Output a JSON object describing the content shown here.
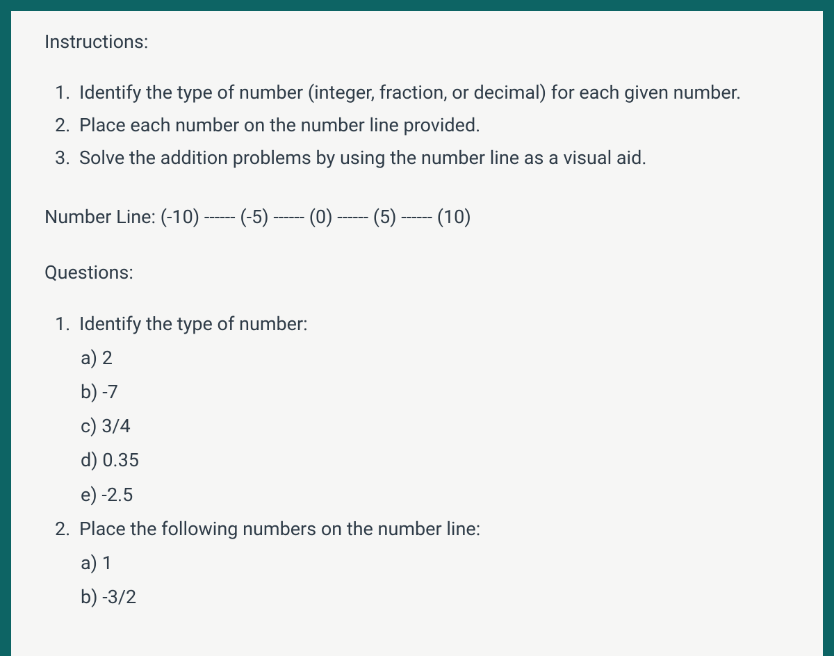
{
  "instructions_heading": "Instructions:",
  "instructions": [
    "Identify the type of number (integer, fraction, or decimal) for each given number.",
    "Place each number on the number line provided.",
    "Solve the addition problems by using the number line as a visual aid."
  ],
  "number_line_text": "Number Line: (-10) ------ (-5) ------ (0) ------ (5) ------ (10)",
  "questions_heading": "Questions:",
  "questions": [
    {
      "prompt": "Identify the type of number:",
      "items": [
        "a) 2",
        "b) -7",
        "c) 3/4",
        "d) 0.35",
        "e) -2.5"
      ]
    },
    {
      "prompt": "Place the following numbers on the number line:",
      "items": [
        "a) 1",
        "b) -3/2"
      ]
    }
  ]
}
